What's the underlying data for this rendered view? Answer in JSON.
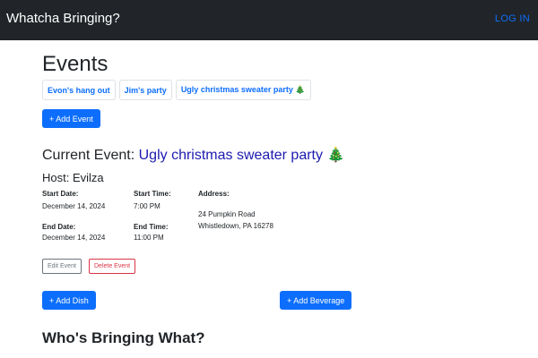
{
  "navbar": {
    "brand": "Whatcha Bringing?",
    "login_label": "LOG IN"
  },
  "events": {
    "title": "Events",
    "tabs": [
      {
        "label": "Evon's hang out"
      },
      {
        "label": "Jim's party"
      },
      {
        "label": "Ugly christmas sweater party 🎄"
      }
    ],
    "add_event_label": "+ Add Event"
  },
  "current_event": {
    "prefix": "Current Event: ",
    "name": "Ugly christmas sweater party 🎄",
    "host": "Host: Evilza",
    "start_date_label": "Start Date:",
    "start_date": "December 14, 2024",
    "start_time_label": "Start Time:",
    "start_time": "7:00 PM",
    "end_date_label": "End Date:",
    "end_date": "December 14, 2024",
    "end_time_label": "End Time:",
    "end_time": "11:00 PM",
    "address_label": "Address:",
    "address_line1": "24 Pumpkin Road",
    "address_line2": "Whistledown, PA 16278",
    "edit_label": "Edit Event",
    "delete_label": "Delete Event"
  },
  "actions": {
    "add_dish_label": "+ Add Dish",
    "add_beverage_label": "+ Add Beverage"
  },
  "section": {
    "whos_bringing": "Who's Bringing What?"
  },
  "colors": {
    "navbar": "#212529",
    "primary": "#0d6efd",
    "event_name": "#1d1bb0",
    "danger": "#dc3545",
    "secondary": "#6c757d"
  }
}
